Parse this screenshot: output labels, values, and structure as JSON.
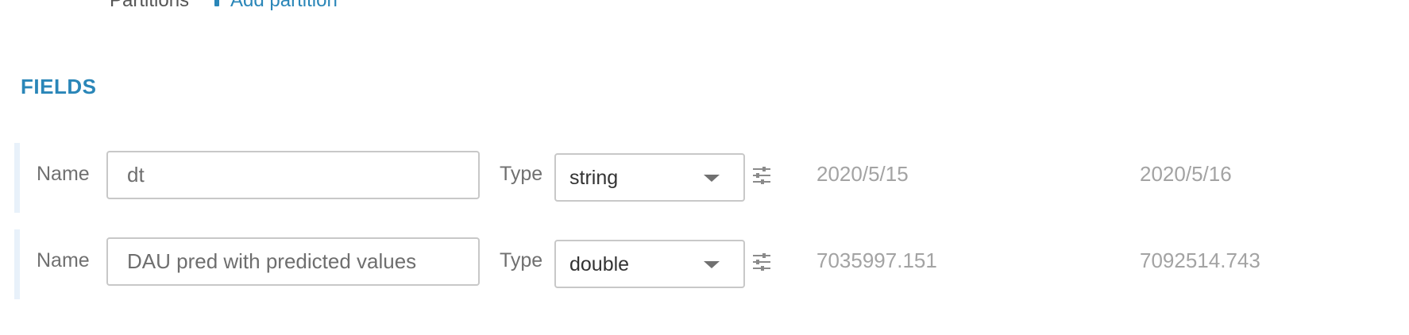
{
  "partitions": {
    "label": "Partitions",
    "add_link": "Add partition"
  },
  "section": {
    "title": "FIELDS"
  },
  "fields": [
    {
      "name_label": "Name",
      "name_value": "dt",
      "type_label": "Type",
      "type_value": "string",
      "samples": [
        "2020/5/15",
        "2020/5/16"
      ]
    },
    {
      "name_label": "Name",
      "name_value": "DAU pred with predicted values",
      "type_label": "Type",
      "type_value": "double",
      "samples": [
        "7035997.151",
        "7092514.743"
      ]
    }
  ],
  "icons": {
    "add": "plus-icon",
    "dropdown": "chevron-down-icon",
    "options": "sliders-icon"
  },
  "colors": {
    "accent": "#2a86b8",
    "row_marker": "#e8f1fa",
    "sample_text": "#a3a3a3"
  }
}
